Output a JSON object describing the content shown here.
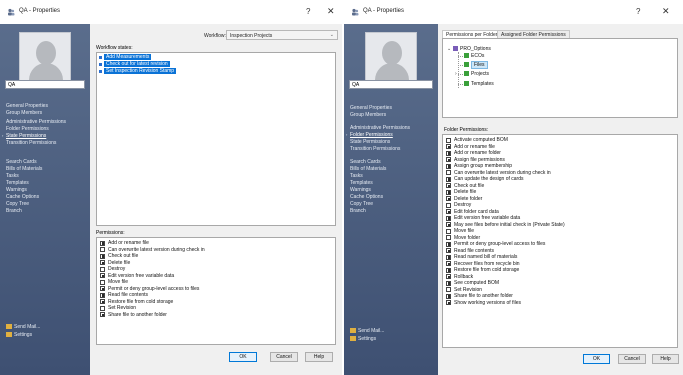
{
  "left_window": {
    "title": "QA - Properties",
    "help_glyph": "?",
    "close_glyph": "✕",
    "user_name": "QA",
    "nav": [
      {
        "label": "General Properties",
        "selected": false
      },
      {
        "label": "Group Members",
        "selected": false
      },
      {
        "label": "Administrative Permissions",
        "selected": false
      },
      {
        "label": "Folder Permissions",
        "selected": false
      },
      {
        "label": "State Permissions",
        "selected": true
      },
      {
        "label": "Transition Permissions",
        "selected": false
      },
      {
        "label": "Search Cards",
        "selected": false
      },
      {
        "label": "Bills of Materials",
        "selected": false
      },
      {
        "label": "Tasks",
        "selected": false
      },
      {
        "label": "Templates",
        "selected": false
      },
      {
        "label": "Warnings",
        "selected": false
      },
      {
        "label": "Cache Options",
        "selected": false
      },
      {
        "label": "Copy Tree",
        "selected": false
      },
      {
        "label": "Branch",
        "selected": false
      }
    ],
    "footer": [
      {
        "label": "Send Mail..."
      },
      {
        "label": "Settings"
      }
    ],
    "workflow_label": "Workflow:",
    "workflow_value": "Inspection Projects",
    "states_label": "Workflow states:",
    "states": [
      "Add Measurements",
      "Check out for latest revision",
      "Set Inspection Revision Stamp"
    ],
    "permissions_label": "Permissions:",
    "permissions": [
      {
        "label": "Add or rename file",
        "checked": true
      },
      {
        "label": "Can overwrite latest version during check in",
        "checked": false
      },
      {
        "label": "Check out file",
        "checked": true
      },
      {
        "label": "Delete file",
        "checked": true
      },
      {
        "label": "Destroy",
        "checked": false
      },
      {
        "label": "Edit version free variable data",
        "checked": true
      },
      {
        "label": "Move file",
        "checked": false
      },
      {
        "label": "Permit or deny group-level access to files",
        "checked": true
      },
      {
        "label": "Read file contents",
        "checked": true
      },
      {
        "label": "Restore file from cold storage",
        "checked": true
      },
      {
        "label": "Set Revision",
        "checked": false
      },
      {
        "label": "Share file to another folder",
        "checked": true
      }
    ],
    "buttons": {
      "ok": "OK",
      "cancel": "Cancel",
      "help": "Help"
    }
  },
  "right_window": {
    "title": "QA - Properties",
    "help_glyph": "?",
    "close_glyph": "✕",
    "user_name": "QA",
    "nav": [
      {
        "label": "General Properties",
        "selected": false
      },
      {
        "label": "Group Members",
        "selected": false
      },
      {
        "label": "Administrative Permissions",
        "selected": false
      },
      {
        "label": "Folder Permissions",
        "selected": true
      },
      {
        "label": "State Permissions",
        "selected": false
      },
      {
        "label": "Transition Permissions",
        "selected": false
      },
      {
        "label": "Search Cards",
        "selected": false
      },
      {
        "label": "Bills of Materials",
        "selected": false
      },
      {
        "label": "Tasks",
        "selected": false
      },
      {
        "label": "Templates",
        "selected": false
      },
      {
        "label": "Warnings",
        "selected": false
      },
      {
        "label": "Cache Options",
        "selected": false
      },
      {
        "label": "Copy Tree",
        "selected": false
      },
      {
        "label": "Branch",
        "selected": false
      }
    ],
    "footer": [
      {
        "label": "Send Mail..."
      },
      {
        "label": "Settings"
      }
    ],
    "tabs": [
      {
        "label": "Permissions per Folder",
        "active": true
      },
      {
        "label": "Assigned Folder Permissions",
        "active": false
      }
    ],
    "tree": {
      "root": "PRO_Options",
      "children": [
        "ECOs",
        "Files",
        "Projects",
        "Templates"
      ],
      "selected": "Files"
    },
    "permissions_label": "Folder Permissions:",
    "permissions": [
      {
        "label": "Activate computed BOM",
        "checked": false
      },
      {
        "label": "Add or rename file",
        "checked": true
      },
      {
        "label": "Add or rename folder",
        "checked": true
      },
      {
        "label": "Assign file permissions",
        "checked": true
      },
      {
        "label": "Assign group membership",
        "checked": true
      },
      {
        "label": "Can overwrite latest version during check in",
        "checked": false
      },
      {
        "label": "Can update the design of cards",
        "checked": true
      },
      {
        "label": "Check out file",
        "checked": true
      },
      {
        "label": "Delete file",
        "checked": true
      },
      {
        "label": "Delete folder",
        "checked": true
      },
      {
        "label": "Destroy",
        "checked": false
      },
      {
        "label": "Edit folder card data",
        "checked": true
      },
      {
        "label": "Edit version free variable data",
        "checked": true
      },
      {
        "label": "May see files before initial check in (Private State)",
        "checked": true
      },
      {
        "label": "Move file",
        "checked": false
      },
      {
        "label": "Move folder",
        "checked": false
      },
      {
        "label": "Permit or deny group-level access to files",
        "checked": true
      },
      {
        "label": "Read file contents",
        "checked": true
      },
      {
        "label": "Read named bill of materials",
        "checked": true
      },
      {
        "label": "Recover files from recycle bin",
        "checked": true
      },
      {
        "label": "Restore file from cold storage",
        "checked": true
      },
      {
        "label": "Rollback",
        "checked": true
      },
      {
        "label": "See computed BOM",
        "checked": true
      },
      {
        "label": "Set Revision",
        "checked": false
      },
      {
        "label": "Share file to another folder",
        "checked": true
      },
      {
        "label": "Show working versions of files",
        "checked": true
      }
    ],
    "buttons": {
      "ok": "OK",
      "cancel": "Cancel",
      "help": "Help"
    }
  }
}
